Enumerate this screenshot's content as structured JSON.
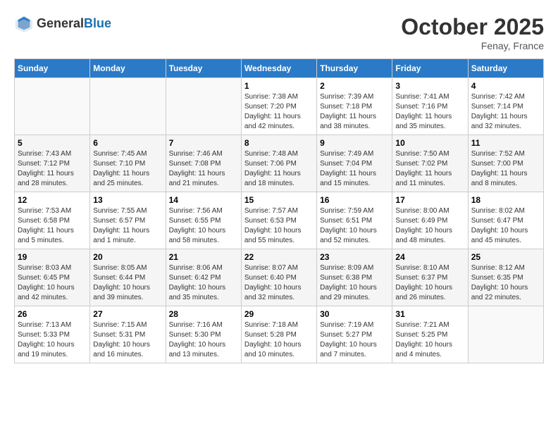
{
  "header": {
    "logo_line1": "General",
    "logo_line2": "Blue",
    "month_title": "October 2025",
    "location": "Fenay, France"
  },
  "days_of_week": [
    "Sunday",
    "Monday",
    "Tuesday",
    "Wednesday",
    "Thursday",
    "Friday",
    "Saturday"
  ],
  "weeks": [
    [
      {
        "day": "",
        "info": ""
      },
      {
        "day": "",
        "info": ""
      },
      {
        "day": "",
        "info": ""
      },
      {
        "day": "1",
        "info": "Sunrise: 7:38 AM\nSunset: 7:20 PM\nDaylight: 11 hours and 42 minutes."
      },
      {
        "day": "2",
        "info": "Sunrise: 7:39 AM\nSunset: 7:18 PM\nDaylight: 11 hours and 38 minutes."
      },
      {
        "day": "3",
        "info": "Sunrise: 7:41 AM\nSunset: 7:16 PM\nDaylight: 11 hours and 35 minutes."
      },
      {
        "day": "4",
        "info": "Sunrise: 7:42 AM\nSunset: 7:14 PM\nDaylight: 11 hours and 32 minutes."
      }
    ],
    [
      {
        "day": "5",
        "info": "Sunrise: 7:43 AM\nSunset: 7:12 PM\nDaylight: 11 hours and 28 minutes."
      },
      {
        "day": "6",
        "info": "Sunrise: 7:45 AM\nSunset: 7:10 PM\nDaylight: 11 hours and 25 minutes."
      },
      {
        "day": "7",
        "info": "Sunrise: 7:46 AM\nSunset: 7:08 PM\nDaylight: 11 hours and 21 minutes."
      },
      {
        "day": "8",
        "info": "Sunrise: 7:48 AM\nSunset: 7:06 PM\nDaylight: 11 hours and 18 minutes."
      },
      {
        "day": "9",
        "info": "Sunrise: 7:49 AM\nSunset: 7:04 PM\nDaylight: 11 hours and 15 minutes."
      },
      {
        "day": "10",
        "info": "Sunrise: 7:50 AM\nSunset: 7:02 PM\nDaylight: 11 hours and 11 minutes."
      },
      {
        "day": "11",
        "info": "Sunrise: 7:52 AM\nSunset: 7:00 PM\nDaylight: 11 hours and 8 minutes."
      }
    ],
    [
      {
        "day": "12",
        "info": "Sunrise: 7:53 AM\nSunset: 6:58 PM\nDaylight: 11 hours and 5 minutes."
      },
      {
        "day": "13",
        "info": "Sunrise: 7:55 AM\nSunset: 6:57 PM\nDaylight: 11 hours and 1 minute."
      },
      {
        "day": "14",
        "info": "Sunrise: 7:56 AM\nSunset: 6:55 PM\nDaylight: 10 hours and 58 minutes."
      },
      {
        "day": "15",
        "info": "Sunrise: 7:57 AM\nSunset: 6:53 PM\nDaylight: 10 hours and 55 minutes."
      },
      {
        "day": "16",
        "info": "Sunrise: 7:59 AM\nSunset: 6:51 PM\nDaylight: 10 hours and 52 minutes."
      },
      {
        "day": "17",
        "info": "Sunrise: 8:00 AM\nSunset: 6:49 PM\nDaylight: 10 hours and 48 minutes."
      },
      {
        "day": "18",
        "info": "Sunrise: 8:02 AM\nSunset: 6:47 PM\nDaylight: 10 hours and 45 minutes."
      }
    ],
    [
      {
        "day": "19",
        "info": "Sunrise: 8:03 AM\nSunset: 6:45 PM\nDaylight: 10 hours and 42 minutes."
      },
      {
        "day": "20",
        "info": "Sunrise: 8:05 AM\nSunset: 6:44 PM\nDaylight: 10 hours and 39 minutes."
      },
      {
        "day": "21",
        "info": "Sunrise: 8:06 AM\nSunset: 6:42 PM\nDaylight: 10 hours and 35 minutes."
      },
      {
        "day": "22",
        "info": "Sunrise: 8:07 AM\nSunset: 6:40 PM\nDaylight: 10 hours and 32 minutes."
      },
      {
        "day": "23",
        "info": "Sunrise: 8:09 AM\nSunset: 6:38 PM\nDaylight: 10 hours and 29 minutes."
      },
      {
        "day": "24",
        "info": "Sunrise: 8:10 AM\nSunset: 6:37 PM\nDaylight: 10 hours and 26 minutes."
      },
      {
        "day": "25",
        "info": "Sunrise: 8:12 AM\nSunset: 6:35 PM\nDaylight: 10 hours and 22 minutes."
      }
    ],
    [
      {
        "day": "26",
        "info": "Sunrise: 7:13 AM\nSunset: 5:33 PM\nDaylight: 10 hours and 19 minutes."
      },
      {
        "day": "27",
        "info": "Sunrise: 7:15 AM\nSunset: 5:31 PM\nDaylight: 10 hours and 16 minutes."
      },
      {
        "day": "28",
        "info": "Sunrise: 7:16 AM\nSunset: 5:30 PM\nDaylight: 10 hours and 13 minutes."
      },
      {
        "day": "29",
        "info": "Sunrise: 7:18 AM\nSunset: 5:28 PM\nDaylight: 10 hours and 10 minutes."
      },
      {
        "day": "30",
        "info": "Sunrise: 7:19 AM\nSunset: 5:27 PM\nDaylight: 10 hours and 7 minutes."
      },
      {
        "day": "31",
        "info": "Sunrise: 7:21 AM\nSunset: 5:25 PM\nDaylight: 10 hours and 4 minutes."
      },
      {
        "day": "",
        "info": ""
      }
    ]
  ]
}
